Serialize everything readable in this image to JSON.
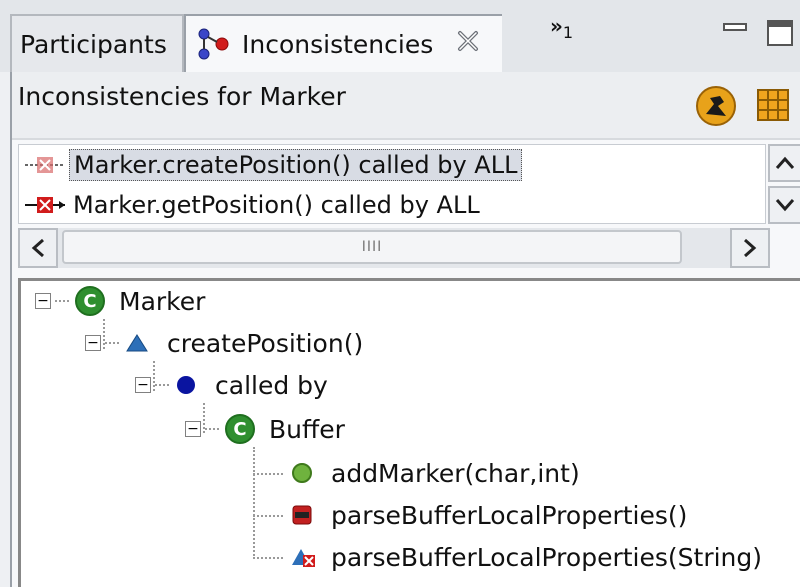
{
  "tabs": [
    {
      "label": "Participants"
    },
    {
      "label": "Inconsistencies"
    }
  ],
  "overflow": {
    "symbol": "»",
    "count": "1"
  },
  "header": {
    "title": "Inconsistencies for  Marker"
  },
  "inconsistencies": [
    {
      "label": "Marker.createPosition() called by ALL"
    },
    {
      "label": "Marker.getPosition() called by ALL"
    }
  ],
  "tree": {
    "root": "Marker",
    "method": "createPosition()",
    "relation": "called by",
    "caller_class": "Buffer",
    "callers": [
      {
        "label": "addMarker(char,int)"
      },
      {
        "label": "parseBufferLocalProperties()"
      },
      {
        "label": "parseBufferLocalProperties(String)"
      }
    ]
  },
  "colors": {
    "class_icon": "#2f8f2f",
    "method_triangle": "#2d6fb8",
    "relation_dot": "#0a14a0",
    "error_red": "#d11c1c"
  },
  "icons": [
    "inconsistency-graph-icon",
    "close-icon",
    "minimize-icon",
    "maximize-icon",
    "filter-icon",
    "grid-icon",
    "error-marker-icon"
  ]
}
